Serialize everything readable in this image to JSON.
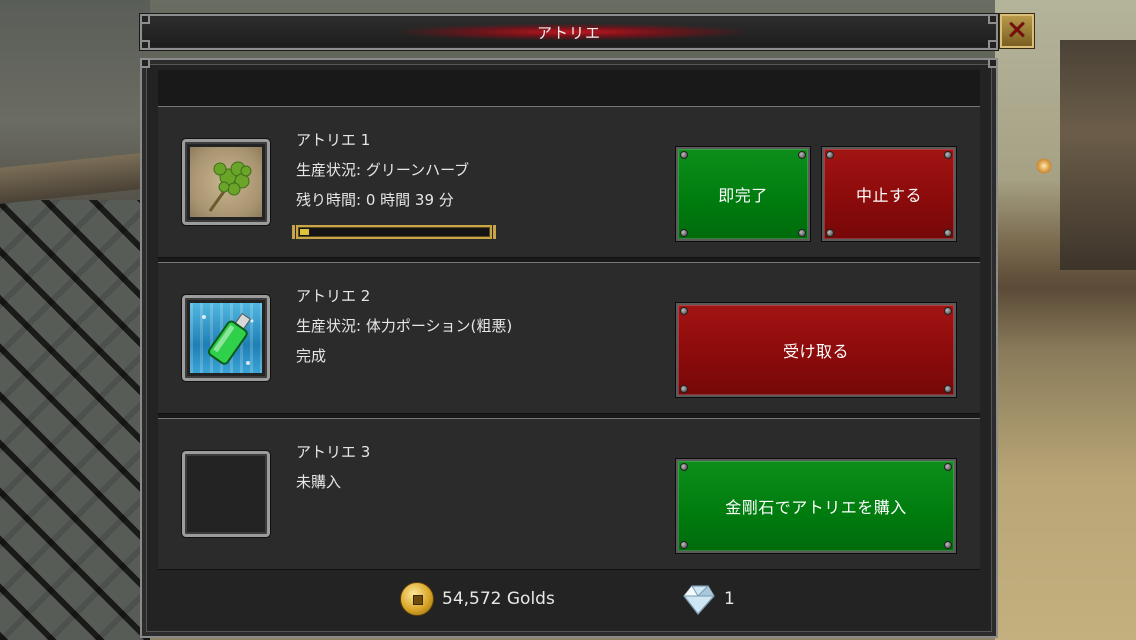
{
  "window": {
    "title": "アトリエ"
  },
  "workshops": [
    {
      "name": "アトリエ 1",
      "status": "生産状況: グリーンハーブ",
      "remaining": "残り時間: 0 時間 39 分",
      "progress": 0.05,
      "item_icon": "green-herb",
      "buttons": [
        "即完了",
        "中止する"
      ]
    },
    {
      "name": "アトリエ 2",
      "status": "生産状況: 体力ポーション(粗悪)",
      "state": "完成",
      "item_icon": "potion",
      "button": "受け取る"
    },
    {
      "name": "アトリエ 3",
      "state": "未購入",
      "item_icon": "",
      "button": "金剛石でアトリエを購入"
    }
  ],
  "currency": {
    "golds": "54,572 Golds",
    "diamonds": "1"
  },
  "colors": {
    "green_button": "#007d0f",
    "red_button": "#8c0b0b",
    "progress_fill": "#e0c13a",
    "title_glow": "#c8141e"
  }
}
